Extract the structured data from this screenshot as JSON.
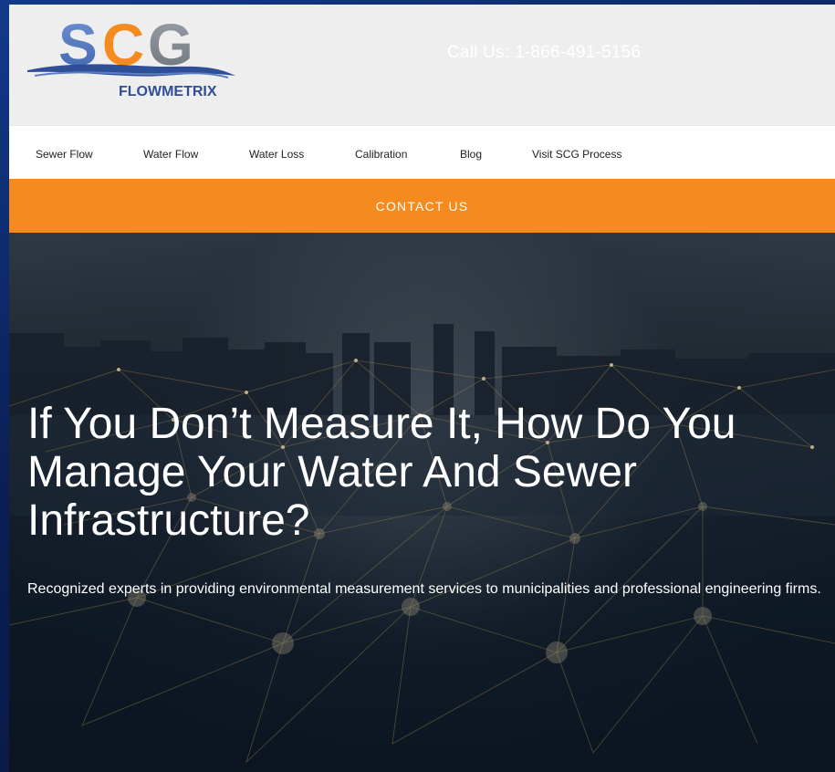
{
  "brand": {
    "logo_letters": "SCG",
    "logo_subtitle": "FLOWMETRIX",
    "colors": {
      "blue": "#5b7fbf",
      "orange": "#f58a1f",
      "gray": "#808890",
      "navy": "#2f4e98"
    }
  },
  "header": {
    "phone_label": "Call Us:",
    "phone_number": "1-866-491-5156"
  },
  "nav": {
    "items": [
      {
        "label": "Sewer Flow"
      },
      {
        "label": "Water Flow"
      },
      {
        "label": "Water Loss"
      },
      {
        "label": "Calibration"
      },
      {
        "label": "Blog"
      },
      {
        "label": "Visit SCG Process"
      }
    ]
  },
  "contact_bar": {
    "label": "CONTACT US",
    "color": "#f58a1f"
  },
  "hero": {
    "headline": "If You Don’t Measure It, How Do You Manage Your Water And Sewer Infrastructure?",
    "subtext": "Recognized experts in providing environmental measurement services to municipalities and professional engineering firms."
  }
}
